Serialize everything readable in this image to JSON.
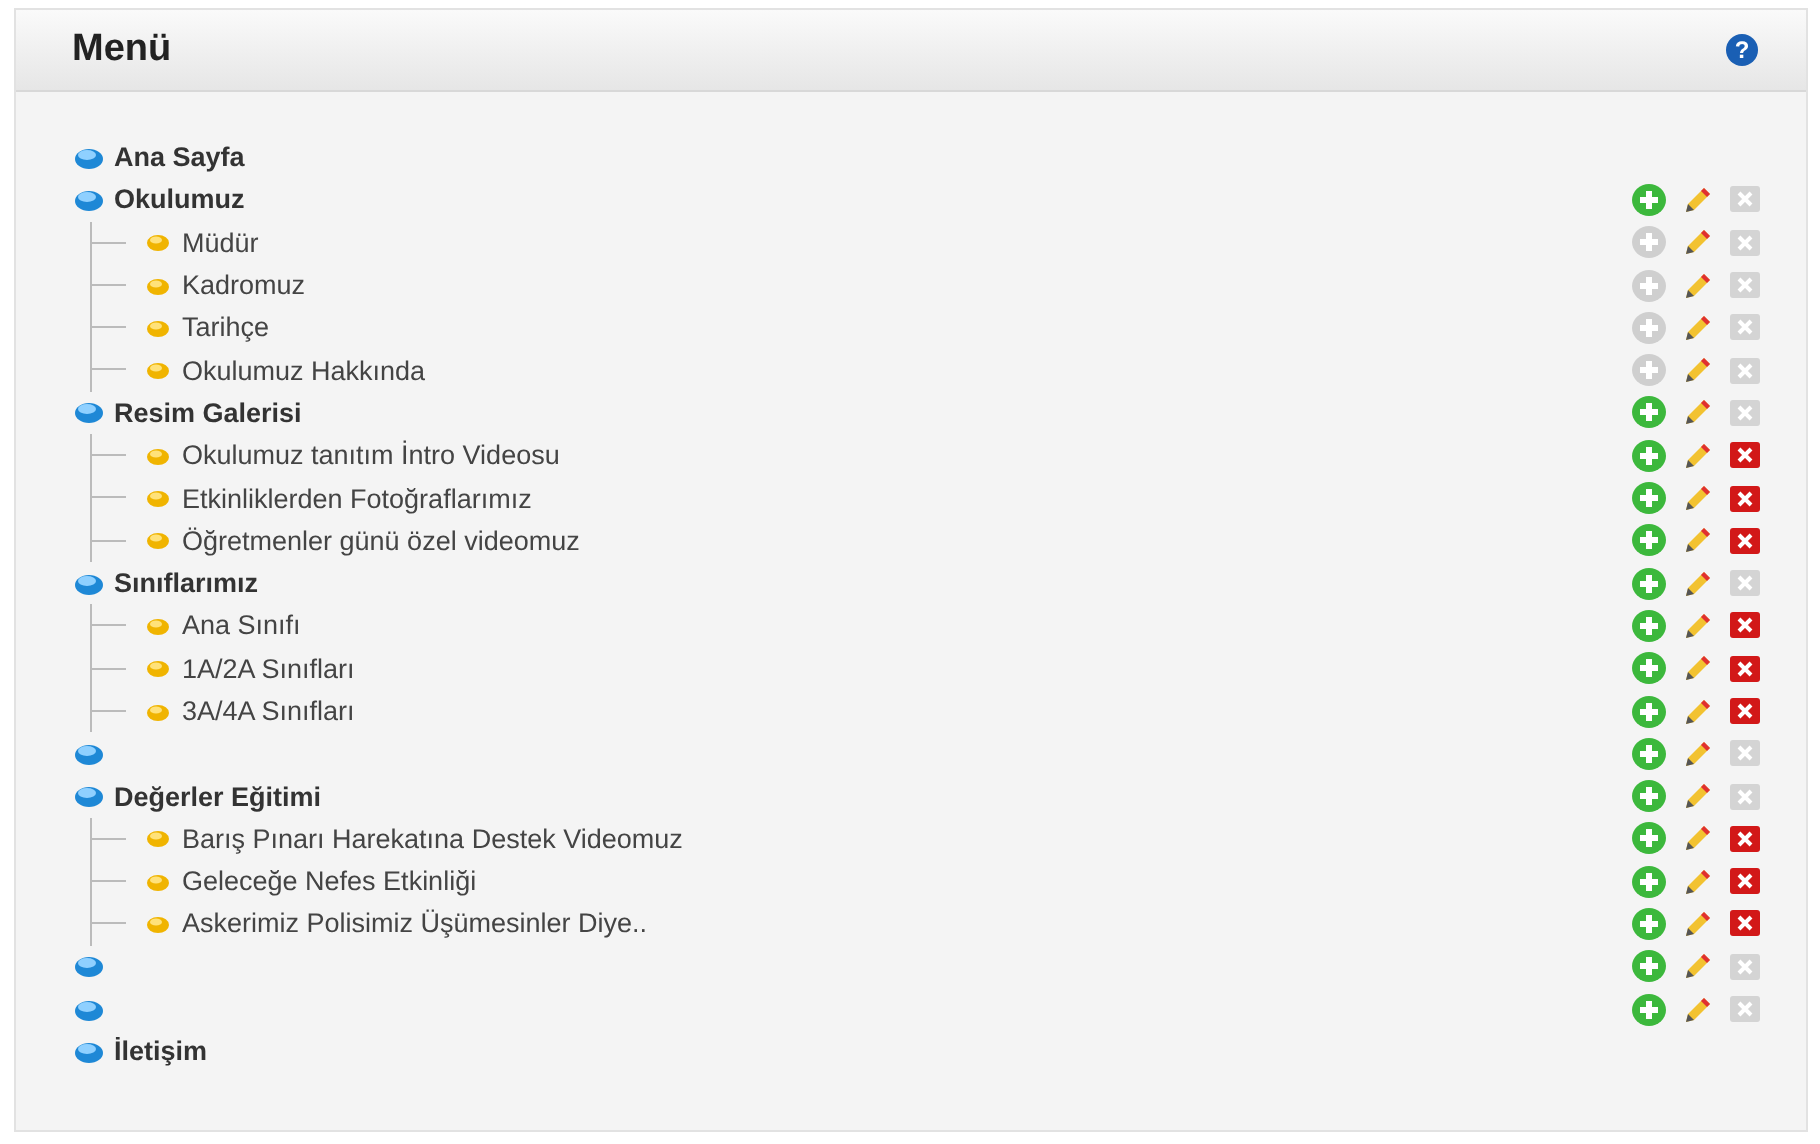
{
  "panel": {
    "title": "Menü",
    "help": "?"
  },
  "tree": [
    {
      "label": "Ana Sayfa"
    },
    {
      "label": "Okulumuz",
      "actions": {
        "add_enabled": true,
        "delete_enabled": false
      },
      "children": [
        {
          "label": "Müdür",
          "actions": {
            "add_enabled": false,
            "delete_enabled": false
          }
        },
        {
          "label": "Kadromuz",
          "actions": {
            "add_enabled": false,
            "delete_enabled": false
          }
        },
        {
          "label": "Tarihçe",
          "actions": {
            "add_enabled": false,
            "delete_enabled": false
          }
        },
        {
          "label": "Okulumuz Hakkında",
          "actions": {
            "add_enabled": false,
            "delete_enabled": false
          }
        }
      ]
    },
    {
      "label": "Resim Galerisi",
      "actions": {
        "add_enabled": true,
        "delete_enabled": false
      },
      "children": [
        {
          "label": "Okulumuz tanıtım İntro Videosu",
          "actions": {
            "add_enabled": true,
            "delete_enabled": true
          }
        },
        {
          "label": "Etkinliklerden Fotoğraflarımız",
          "actions": {
            "add_enabled": true,
            "delete_enabled": true
          }
        },
        {
          "label": "Öğretmenler günü özel videomuz",
          "actions": {
            "add_enabled": true,
            "delete_enabled": true
          }
        }
      ]
    },
    {
      "label": "Sınıflarımız",
      "actions": {
        "add_enabled": true,
        "delete_enabled": false
      },
      "children": [
        {
          "label": "Ana Sınıfı",
          "actions": {
            "add_enabled": true,
            "delete_enabled": true
          }
        },
        {
          "label": "1A/2A Sınıfları",
          "actions": {
            "add_enabled": true,
            "delete_enabled": true
          }
        },
        {
          "label": "3A/4A Sınıfları",
          "actions": {
            "add_enabled": true,
            "delete_enabled": true
          }
        }
      ]
    },
    {
      "actions": {
        "add_enabled": true,
        "delete_enabled": false
      }
    },
    {
      "label": "Değerler Eğitimi",
      "actions": {
        "add_enabled": true,
        "delete_enabled": false
      },
      "children": [
        {
          "label": "Barış Pınarı Harekatına Destek Videomuz",
          "actions": {
            "add_enabled": true,
            "delete_enabled": true
          }
        },
        {
          "label": "Geleceğe Nefes Etkinliği",
          "actions": {
            "add_enabled": true,
            "delete_enabled": true
          }
        },
        {
          "label": "Askerimiz Polisimiz Üşümesinler Diye..",
          "actions": {
            "add_enabled": true,
            "delete_enabled": true
          }
        }
      ]
    },
    {
      "actions": {
        "add_enabled": true,
        "delete_enabled": false
      }
    },
    {
      "actions": {
        "add_enabled": true,
        "delete_enabled": false
      }
    },
    {
      "label": "İletişim"
    }
  ]
}
